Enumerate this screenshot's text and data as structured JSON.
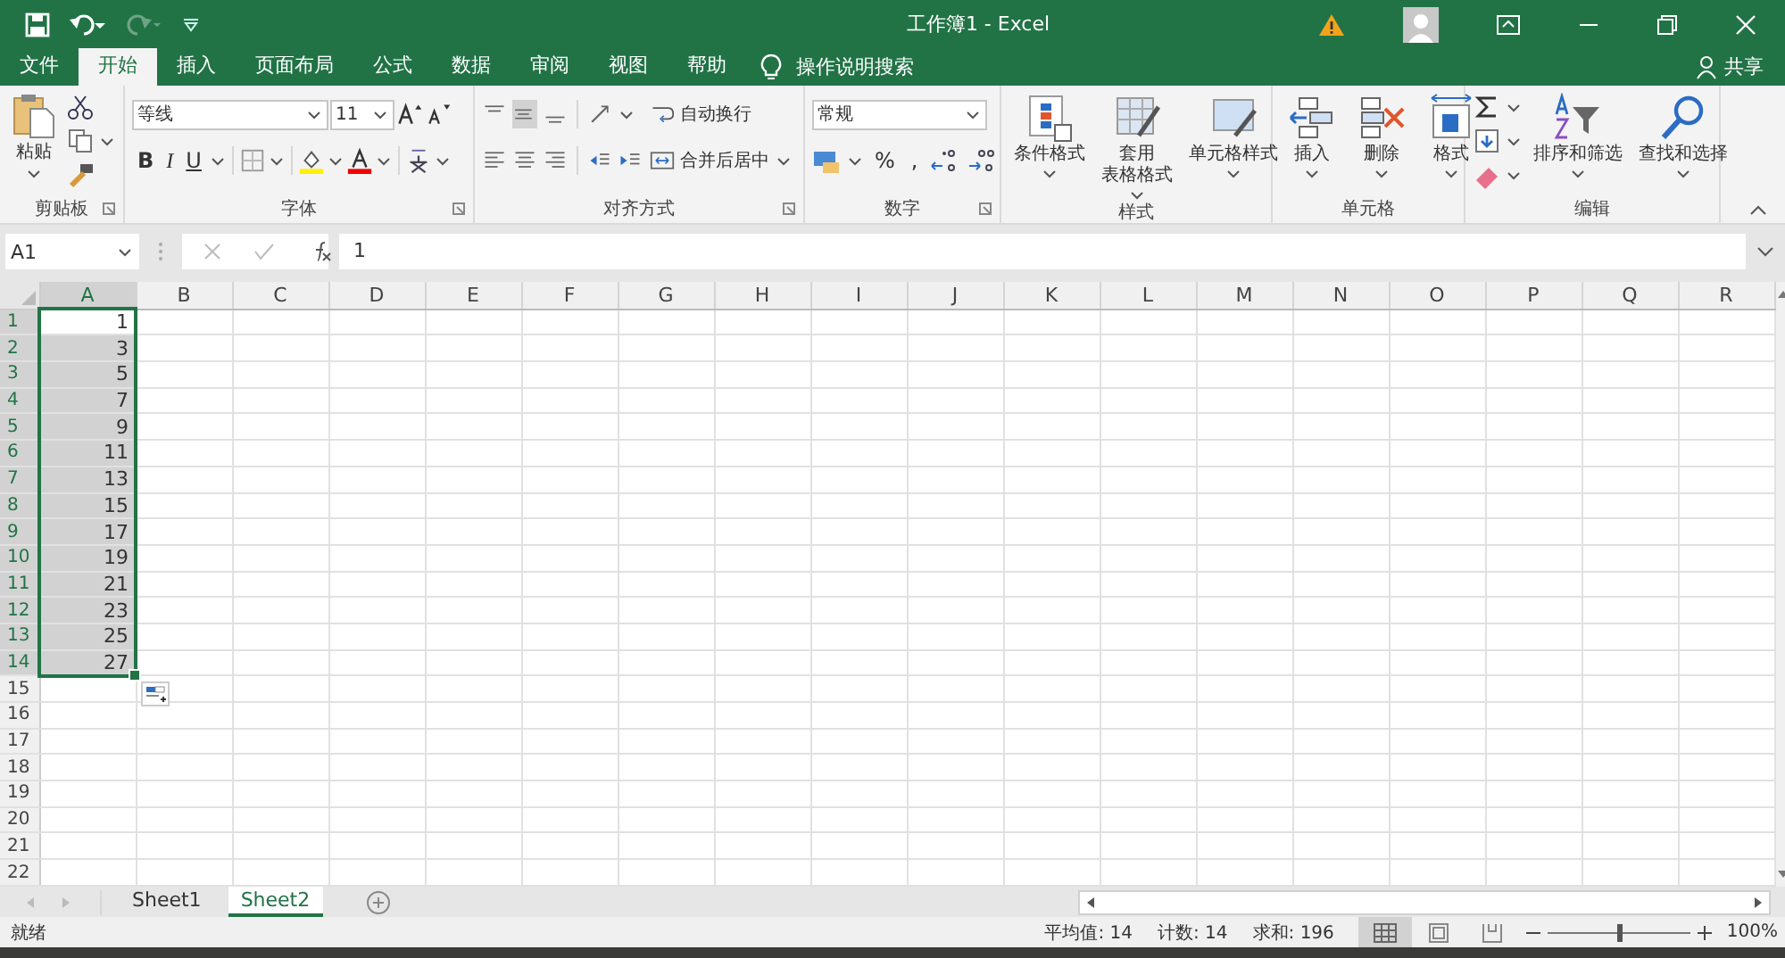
{
  "title_bar": {
    "title": "工作簿1  -  Excel"
  },
  "ribbon_tabs": [
    {
      "label": "文件",
      "selected": false
    },
    {
      "label": "开始",
      "selected": true
    },
    {
      "label": "插入",
      "selected": false
    },
    {
      "label": "页面布局",
      "selected": false
    },
    {
      "label": "公式",
      "selected": false
    },
    {
      "label": "数据",
      "selected": false
    },
    {
      "label": "审阅",
      "selected": false
    },
    {
      "label": "视图",
      "selected": false
    },
    {
      "label": "帮助",
      "selected": false
    }
  ],
  "tell_me": "操作说明搜索",
  "share": "共享",
  "ribbon_groups": [
    {
      "kind": "clipboard",
      "label": "剪贴板",
      "paste": "粘贴"
    },
    {
      "kind": "font",
      "label": "字体",
      "font_name": "等线",
      "font_size": "11",
      "bold": "B",
      "italic": "I",
      "underline": "U"
    },
    {
      "kind": "alignment",
      "label": "对齐方式",
      "wrap": "自动换行",
      "merge": "合并后居中"
    },
    {
      "kind": "number",
      "label": "数字",
      "format": "常规",
      "percent": "%",
      "comma": ","
    },
    {
      "kind": "styles",
      "label": "样式",
      "buttons": [
        [
          "条件格式"
        ],
        [
          "套用",
          "表格格式"
        ],
        [
          "单元格样式"
        ]
      ]
    },
    {
      "kind": "cells",
      "label": "单元格",
      "buttons": [
        "插入",
        "删除",
        "格式"
      ]
    },
    {
      "kind": "editing",
      "label": "编辑",
      "buttons": [
        "排序和筛选",
        "查找和选择"
      ]
    }
  ],
  "formula_bar": {
    "name_box": "A1",
    "formula": "1"
  },
  "columns": [
    {
      "label": "A",
      "selected": true
    },
    {
      "label": "B",
      "selected": false
    },
    {
      "label": "C",
      "selected": false
    },
    {
      "label": "D",
      "selected": false
    },
    {
      "label": "E",
      "selected": false
    },
    {
      "label": "F",
      "selected": false
    },
    {
      "label": "G",
      "selected": false
    },
    {
      "label": "H",
      "selected": false
    },
    {
      "label": "I",
      "selected": false
    },
    {
      "label": "J",
      "selected": false
    },
    {
      "label": "K",
      "selected": false
    },
    {
      "label": "L",
      "selected": false
    },
    {
      "label": "M",
      "selected": false
    },
    {
      "label": "N",
      "selected": false
    },
    {
      "label": "O",
      "selected": false
    },
    {
      "label": "P",
      "selected": false
    },
    {
      "label": "Q",
      "selected": false
    },
    {
      "label": "R",
      "selected": false
    }
  ],
  "rows": [
    {
      "number": "1",
      "value": "1",
      "selected": true
    },
    {
      "number": "2",
      "value": "3",
      "selected": true
    },
    {
      "number": "3",
      "value": "5",
      "selected": true
    },
    {
      "number": "4",
      "value": "7",
      "selected": true
    },
    {
      "number": "5",
      "value": "9",
      "selected": true
    },
    {
      "number": "6",
      "value": "11",
      "selected": true
    },
    {
      "number": "7",
      "value": "13",
      "selected": true
    },
    {
      "number": "8",
      "value": "15",
      "selected": true
    },
    {
      "number": "9",
      "value": "17",
      "selected": true
    },
    {
      "number": "10",
      "value": "19",
      "selected": true
    },
    {
      "number": "11",
      "value": "21",
      "selected": true
    },
    {
      "number": "12",
      "value": "23",
      "selected": true
    },
    {
      "number": "13",
      "value": "25",
      "selected": true
    },
    {
      "number": "14",
      "value": "27",
      "selected": true
    },
    {
      "number": "15",
      "selected": false
    },
    {
      "number": "16",
      "selected": false
    },
    {
      "number": "17",
      "selected": false
    },
    {
      "number": "18",
      "selected": false
    },
    {
      "number": "19",
      "selected": false
    },
    {
      "number": "20",
      "selected": false
    },
    {
      "number": "21",
      "selected": false
    },
    {
      "number": "22",
      "selected": false
    }
  ],
  "sheets": [
    {
      "label": "Sheet1",
      "selected": false
    },
    {
      "label": "Sheet2",
      "selected": true
    }
  ],
  "status_bar": {
    "ready": "就绪",
    "stats": [
      "平均值: 14",
      "计数: 14",
      "求和: 196"
    ],
    "views": [
      {
        "selected": true
      },
      {
        "selected": false
      },
      {
        "selected": false
      }
    ],
    "zoom": {
      "level": 0.5
    },
    "zoom_text": "100%"
  }
}
